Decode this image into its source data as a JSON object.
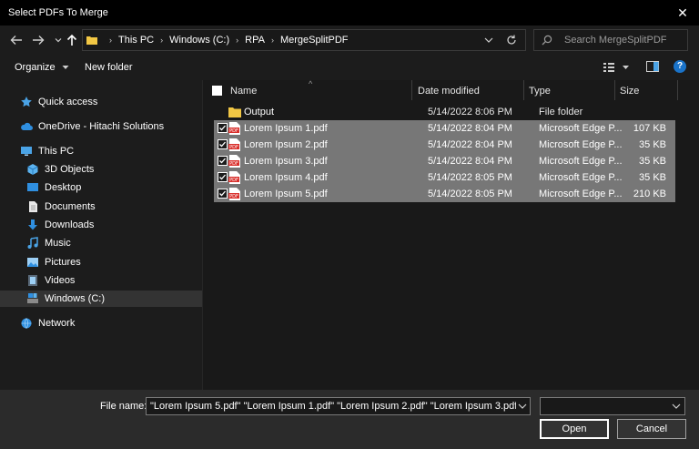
{
  "window": {
    "title": "Select PDFs To Merge",
    "close_label": "✕"
  },
  "address": {
    "crumbs": [
      "This PC",
      "Windows (C:)",
      "RPA",
      "MergeSplitPDF"
    ]
  },
  "search": {
    "placeholder": "Search MergeSplitPDF"
  },
  "toolbar": {
    "organize": "Organize",
    "new_folder": "New folder",
    "help": "?"
  },
  "nav": {
    "items": [
      {
        "label": "Quick access",
        "icon": "star-icon"
      },
      {
        "label": "OneDrive - Hitachi Solutions",
        "icon": "cloud-icon"
      },
      {
        "label": "This PC",
        "icon": "monitor-icon"
      },
      {
        "label": "3D Objects",
        "icon": "cube-icon"
      },
      {
        "label": "Desktop",
        "icon": "desktop-icon"
      },
      {
        "label": "Documents",
        "icon": "document-icon"
      },
      {
        "label": "Downloads",
        "icon": "download-icon"
      },
      {
        "label": "Music",
        "icon": "music-icon"
      },
      {
        "label": "Pictures",
        "icon": "picture-icon"
      },
      {
        "label": "Videos",
        "icon": "video-icon"
      },
      {
        "label": "Windows (C:)",
        "icon": "drive-icon"
      },
      {
        "label": "Network",
        "icon": "network-icon"
      }
    ]
  },
  "columns": {
    "name": "Name",
    "date": "Date modified",
    "type": "Type",
    "size": "Size"
  },
  "files": [
    {
      "name": "Output",
      "date": "5/14/2022 8:06 PM",
      "type": "File folder",
      "size": "",
      "selected": false,
      "kind": "folder"
    },
    {
      "name": "Lorem Ipsum 1.pdf",
      "date": "5/14/2022 8:04 PM",
      "type": "Microsoft Edge P...",
      "size": "107 KB",
      "selected": true,
      "kind": "pdf"
    },
    {
      "name": "Lorem Ipsum 2.pdf",
      "date": "5/14/2022 8:04 PM",
      "type": "Microsoft Edge P...",
      "size": "35 KB",
      "selected": true,
      "kind": "pdf"
    },
    {
      "name": "Lorem Ipsum 3.pdf",
      "date": "5/14/2022 8:04 PM",
      "type": "Microsoft Edge P...",
      "size": "35 KB",
      "selected": true,
      "kind": "pdf"
    },
    {
      "name": "Lorem Ipsum 4.pdf",
      "date": "5/14/2022 8:05 PM",
      "type": "Microsoft Edge P...",
      "size": "35 KB",
      "selected": true,
      "kind": "pdf"
    },
    {
      "name": "Lorem Ipsum 5.pdf",
      "date": "5/14/2022 8:05 PM",
      "type": "Microsoft Edge P...",
      "size": "210 KB",
      "selected": true,
      "kind": "pdf"
    }
  ],
  "footer": {
    "file_name_label": "File name:",
    "file_name_value": "\"Lorem Ipsum 5.pdf\" \"Lorem Ipsum 1.pdf\" \"Lorem Ipsum 2.pdf\" \"Lorem Ipsum 3.pdf\" \"Lor",
    "file_type_value": "",
    "open": "Open",
    "cancel": "Cancel"
  },
  "colors": {
    "accent": "#1a73c9",
    "folder": "#f2c744",
    "pdf": "#d9302c",
    "selection": "#777777"
  }
}
